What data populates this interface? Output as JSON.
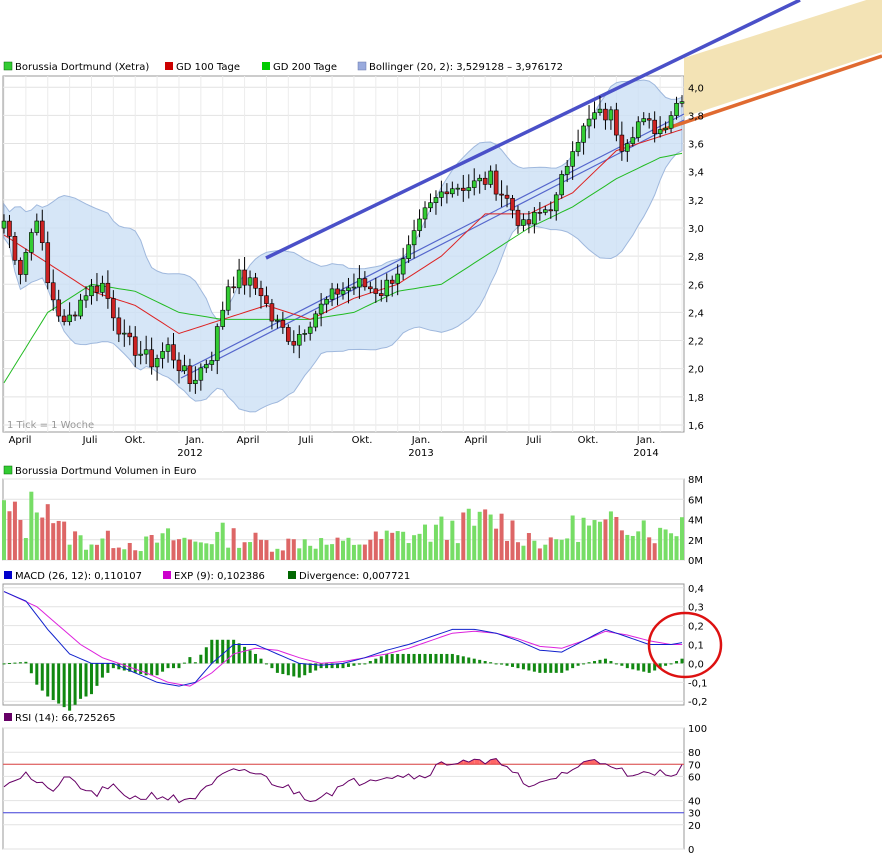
{
  "chart_data": [
    {
      "type": "candlestick",
      "panel": "price",
      "legend": [
        {
          "label": "Borussia Dortmund (Xetra)",
          "color": "#33cc33"
        },
        {
          "label": "GD 100 Tage",
          "color": "#cc0000"
        },
        {
          "label": "GD 200 Tage",
          "color": "#00cc00"
        },
        {
          "label": "Bollinger (20, 2): 3,529128 – 3,976172",
          "color": "#99aadd"
        }
      ],
      "y_ticks": [
        "4,0",
        "3,8",
        "3,6",
        "3,4",
        "3,2",
        "3,0",
        "2,8",
        "2,6",
        "2,4",
        "2,2",
        "2,0",
        "1,8",
        "1,6"
      ],
      "ylim": [
        1.55,
        4.08
      ],
      "x_month_labels": [
        "April",
        "Juli",
        "Okt.",
        "Jan.",
        "April",
        "Juli",
        "Okt.",
        "Jan.",
        "April",
        "Juli",
        "Okt.",
        "Jan."
      ],
      "x_year_labels": [
        "2012",
        "2013",
        "2014"
      ],
      "note": "1 Tick = 1 Woche",
      "close_keypoints": [
        [
          0,
          3.05
        ],
        [
          3,
          2.7
        ],
        [
          6,
          3.1
        ],
        [
          8,
          2.6
        ],
        [
          11,
          2.3
        ],
        [
          15,
          2.55
        ],
        [
          18,
          2.6
        ],
        [
          22,
          2.2
        ],
        [
          27,
          2.05
        ],
        [
          30,
          2.15
        ],
        [
          34,
          1.9
        ],
        [
          38,
          2.1
        ],
        [
          41,
          2.6
        ],
        [
          43,
          2.65
        ],
        [
          47,
          2.55
        ],
        [
          49,
          2.35
        ],
        [
          53,
          2.2
        ],
        [
          57,
          2.4
        ],
        [
          61,
          2.55
        ],
        [
          65,
          2.6
        ],
        [
          69,
          2.55
        ],
        [
          73,
          2.75
        ],
        [
          77,
          3.1
        ],
        [
          81,
          3.3
        ],
        [
          85,
          3.3
        ],
        [
          89,
          3.35
        ],
        [
          92,
          3.2
        ],
        [
          95,
          3.0
        ],
        [
          98,
          3.1
        ],
        [
          101,
          3.2
        ],
        [
          104,
          3.6
        ],
        [
          108,
          3.8
        ],
        [
          111,
          3.8
        ],
        [
          113,
          3.6
        ],
        [
          116,
          3.75
        ],
        [
          120,
          3.7
        ],
        [
          124,
          3.95
        ]
      ],
      "sma100_keypoints": [
        [
          0,
          2.95
        ],
        [
          8,
          2.75
        ],
        [
          16,
          2.55
        ],
        [
          24,
          2.45
        ],
        [
          32,
          2.25
        ],
        [
          40,
          2.35
        ],
        [
          48,
          2.45
        ],
        [
          56,
          2.35
        ],
        [
          64,
          2.5
        ],
        [
          72,
          2.6
        ],
        [
          80,
          2.8
        ],
        [
          88,
          3.1
        ],
        [
          96,
          3.1
        ],
        [
          104,
          3.25
        ],
        [
          112,
          3.55
        ],
        [
          120,
          3.65
        ],
        [
          124,
          3.7
        ]
      ],
      "sma200_keypoints": [
        [
          0,
          1.9
        ],
        [
          8,
          2.4
        ],
        [
          16,
          2.6
        ],
        [
          24,
          2.55
        ],
        [
          32,
          2.4
        ],
        [
          40,
          2.35
        ],
        [
          48,
          2.35
        ],
        [
          56,
          2.35
        ],
        [
          64,
          2.4
        ],
        [
          72,
          2.55
        ],
        [
          80,
          2.6
        ],
        [
          88,
          2.8
        ],
        [
          96,
          3.0
        ],
        [
          104,
          3.15
        ],
        [
          112,
          3.35
        ],
        [
          120,
          3.5
        ],
        [
          124,
          3.53
        ]
      ]
    },
    {
      "type": "bar",
      "panel": "volume",
      "legend": [
        {
          "label": "Borussia Dortmund Volumen in Euro",
          "color": "#33cc33"
        }
      ],
      "y_ticks": [
        "8M",
        "6M",
        "4M",
        "2M",
        "0M"
      ],
      "ylim": [
        0,
        8
      ],
      "volume_keypoints": [
        [
          0,
          4.8
        ],
        [
          4,
          3.5
        ],
        [
          7,
          7.6
        ],
        [
          10,
          3.0
        ],
        [
          15,
          1.8
        ],
        [
          20,
          2.0
        ],
        [
          25,
          1.5
        ],
        [
          30,
          2.2
        ],
        [
          35,
          1.8
        ],
        [
          40,
          2.5
        ],
        [
          45,
          2.0
        ],
        [
          50,
          1.5
        ],
        [
          55,
          2.0
        ],
        [
          60,
          1.5
        ],
        [
          65,
          1.8
        ],
        [
          70,
          2.2
        ],
        [
          75,
          2.5
        ],
        [
          80,
          3.0
        ],
        [
          85,
          3.5
        ],
        [
          90,
          4.0
        ],
        [
          95,
          2.5
        ],
        [
          100,
          1.5
        ],
        [
          105,
          3.5
        ],
        [
          110,
          3.0
        ],
        [
          115,
          4.5
        ],
        [
          120,
          2.5
        ],
        [
          124,
          4.0
        ]
      ]
    },
    {
      "type": "line",
      "panel": "macd",
      "legend": [
        {
          "label": "MACD (26, 12): 0,110107",
          "color": "#0000cc"
        },
        {
          "label": "EXP (9): 0,102386",
          "color": "#cc00cc"
        },
        {
          "label": "Divergence: 0,007721",
          "color": "#006600"
        }
      ],
      "y_ticks": [
        "0,4",
        "0,3",
        "0,2",
        "0,1",
        "0,0",
        "-0,1",
        "-0,2"
      ],
      "ylim": [
        -0.22,
        0.42
      ],
      "macd_keypoints": [
        [
          0,
          0.38
        ],
        [
          4,
          0.33
        ],
        [
          8,
          0.18
        ],
        [
          12,
          0.05
        ],
        [
          16,
          0.0
        ],
        [
          20,
          0.0
        ],
        [
          24,
          -0.05
        ],
        [
          28,
          -0.1
        ],
        [
          32,
          -0.12
        ],
        [
          35,
          -0.1
        ],
        [
          38,
          0.0
        ],
        [
          42,
          0.1
        ],
        [
          46,
          0.1
        ],
        [
          50,
          0.05
        ],
        [
          54,
          0.0
        ],
        [
          58,
          -0.01
        ],
        [
          62,
          0.0
        ],
        [
          66,
          0.03
        ],
        [
          70,
          0.07
        ],
        [
          74,
          0.1
        ],
        [
          78,
          0.14
        ],
        [
          82,
          0.18
        ],
        [
          86,
          0.18
        ],
        [
          90,
          0.16
        ],
        [
          94,
          0.12
        ],
        [
          98,
          0.07
        ],
        [
          102,
          0.06
        ],
        [
          106,
          0.12
        ],
        [
          110,
          0.18
        ],
        [
          114,
          0.14
        ],
        [
          118,
          0.1
        ],
        [
          122,
          0.1
        ],
        [
          124,
          0.11
        ]
      ],
      "exp_keypoints": [
        [
          0,
          0.38
        ],
        [
          6,
          0.3
        ],
        [
          10,
          0.2
        ],
        [
          14,
          0.1
        ],
        [
          18,
          0.03
        ],
        [
          22,
          -0.01
        ],
        [
          26,
          -0.05
        ],
        [
          30,
          -0.1
        ],
        [
          34,
          -0.12
        ],
        [
          38,
          -0.05
        ],
        [
          42,
          0.05
        ],
        [
          46,
          0.08
        ],
        [
          50,
          0.07
        ],
        [
          54,
          0.03
        ],
        [
          58,
          0.0
        ],
        [
          62,
          0.01
        ],
        [
          66,
          0.03
        ],
        [
          70,
          0.05
        ],
        [
          74,
          0.08
        ],
        [
          78,
          0.12
        ],
        [
          82,
          0.16
        ],
        [
          86,
          0.17
        ],
        [
          90,
          0.16
        ],
        [
          94,
          0.13
        ],
        [
          98,
          0.09
        ],
        [
          102,
          0.08
        ],
        [
          106,
          0.12
        ],
        [
          110,
          0.17
        ],
        [
          114,
          0.15
        ],
        [
          118,
          0.12
        ],
        [
          122,
          0.1
        ],
        [
          124,
          0.1
        ]
      ]
    },
    {
      "type": "line",
      "panel": "rsi",
      "legend": [
        {
          "label": "RSI (14): 66,725265",
          "color": "#660066"
        }
      ],
      "y_ticks": [
        "100",
        "80",
        "70",
        "60",
        "40",
        "30",
        "20",
        "0"
      ],
      "ylim": [
        0,
        100
      ],
      "levels": [
        70,
        30
      ],
      "rsi_keypoints": [
        [
          0,
          55
        ],
        [
          4,
          62
        ],
        [
          8,
          48
        ],
        [
          12,
          58
        ],
        [
          16,
          45
        ],
        [
          20,
          50
        ],
        [
          24,
          42
        ],
        [
          28,
          45
        ],
        [
          32,
          40
        ],
        [
          36,
          45
        ],
        [
          40,
          60
        ],
        [
          44,
          66
        ],
        [
          48,
          58
        ],
        [
          52,
          50
        ],
        [
          56,
          42
        ],
        [
          60,
          48
        ],
        [
          64,
          55
        ],
        [
          68,
          60
        ],
        [
          72,
          62
        ],
        [
          76,
          60
        ],
        [
          80,
          70
        ],
        [
          84,
          74
        ],
        [
          88,
          70
        ],
        [
          92,
          72
        ],
        [
          96,
          48
        ],
        [
          100,
          58
        ],
        [
          104,
          66
        ],
        [
          108,
          74
        ],
        [
          112,
          70
        ],
        [
          114,
          58
        ],
        [
          118,
          62
        ],
        [
          122,
          64
        ],
        [
          124,
          66.7
        ]
      ]
    }
  ]
}
